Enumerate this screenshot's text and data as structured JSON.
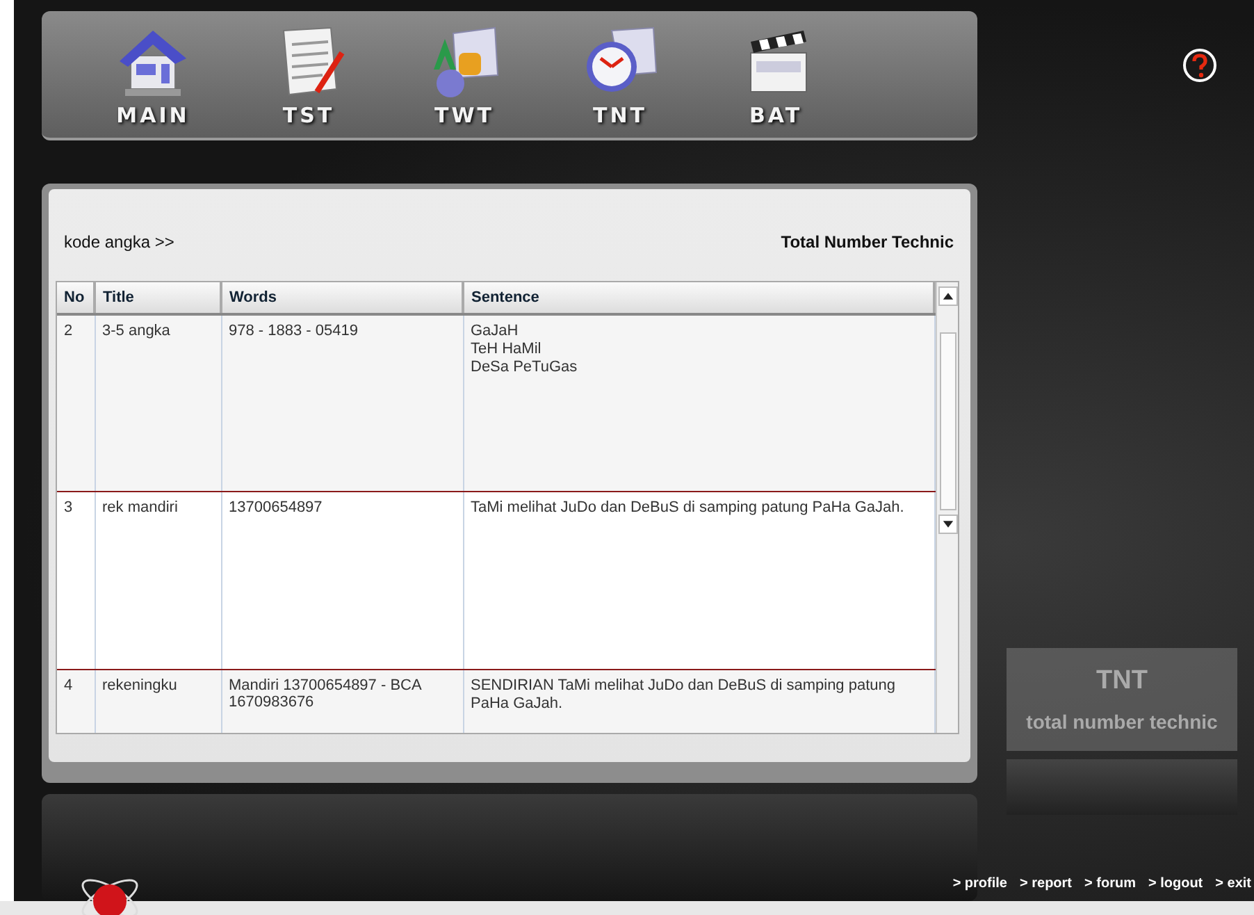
{
  "nav": [
    {
      "label": "MAIN",
      "kind": "house"
    },
    {
      "label": "TST",
      "kind": "document"
    },
    {
      "label": "TWT",
      "kind": "letters"
    },
    {
      "label": "TNT",
      "kind": "clock"
    },
    {
      "label": "BAT",
      "kind": "clapperboard"
    }
  ],
  "panel": {
    "breadcrumb": "kode angka >>",
    "title": "Total Number Technic"
  },
  "table": {
    "columns": [
      "No",
      "Title",
      "Words",
      "Sentence"
    ],
    "rows": [
      {
        "no": "2",
        "title": "3-5 angka",
        "words": "978 - 1883 - 05419",
        "sentence": [
          "GaJaH",
          "TeH HaMil",
          "DeSa PeTuGas"
        ]
      },
      {
        "no": "3",
        "title": "rek mandiri",
        "words": "13700654897",
        "sentence": [
          "TaMi melihat JuDo dan DeBuS di samping patung PaHa GaJah."
        ]
      },
      {
        "no": "4",
        "title": "rekeningku",
        "words": "Mandiri 13700654897 - BCA 1670983676",
        "sentence": [
          "SENDIRIAN TaMi melihat JuDo dan DeBuS di samping patung PaHa GaJah."
        ]
      }
    ]
  },
  "info_box": {
    "title": "TNT",
    "subtitle": "total number technic"
  },
  "footer_links": [
    "> profile",
    "> report",
    "> forum",
    "> logout",
    "> exit"
  ]
}
